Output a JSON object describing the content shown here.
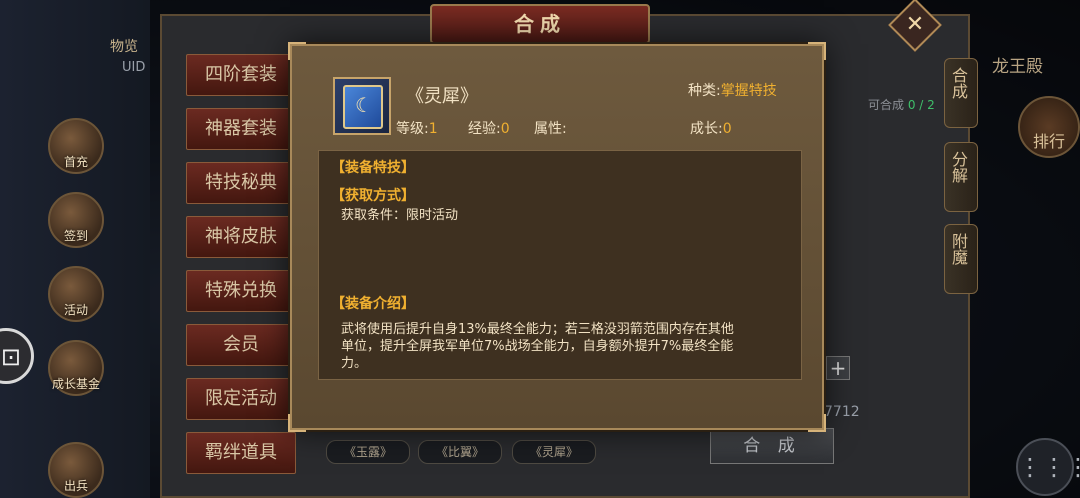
{
  "back_panel": {
    "title": "合成",
    "close_icon": "close-icon",
    "player_name": "物览",
    "uid_label": "UID",
    "menu_items": [
      "四阶套装",
      "神器套装",
      "特技秘典",
      "神将皮肤",
      "特殊兑换",
      "会员",
      "限定活动",
      "羁绊道具"
    ],
    "left_buttons": [
      "首充",
      "签到",
      "活动",
      "成长基金",
      "出兵"
    ],
    "right_tabs": [
      "合成",
      "分解",
      "附魔"
    ],
    "right_title": "龙王殿",
    "can_merge_label": "可合成",
    "can_merge_count": "0 / 2",
    "right_circle_label": "排行",
    "merge_button": "合 成",
    "number_fragment": "7712",
    "slot_labels": [
      "《玉露》",
      "《比翼》",
      "《灵犀》"
    ],
    "plus_label": "+",
    "menu_icon": "more-icon"
  },
  "modal": {
    "item_name": "《灵犀》",
    "kind_label": "种类:",
    "kind_value": "掌握特技",
    "level_label": "等级:",
    "level_value": "1",
    "exp_label": "经验:",
    "exp_value": "0",
    "attr_label": "属性:",
    "growth_label": "成长:",
    "growth_value": "0",
    "sections": {
      "equip_skill": "【装备特技】",
      "obtain_way": "【获取方式】",
      "obtain_condition": "获取条件：限时活动",
      "equip_intro": "【装备介绍】",
      "intro_line1": "武将使用后提升自身13%最终全能力；若三格没羽箭范围内存在其他",
      "intro_line2": "单位，提升全屏我军单位7%战场全能力，自身额外提升7%最终全能",
      "intro_line3": "力。"
    }
  }
}
